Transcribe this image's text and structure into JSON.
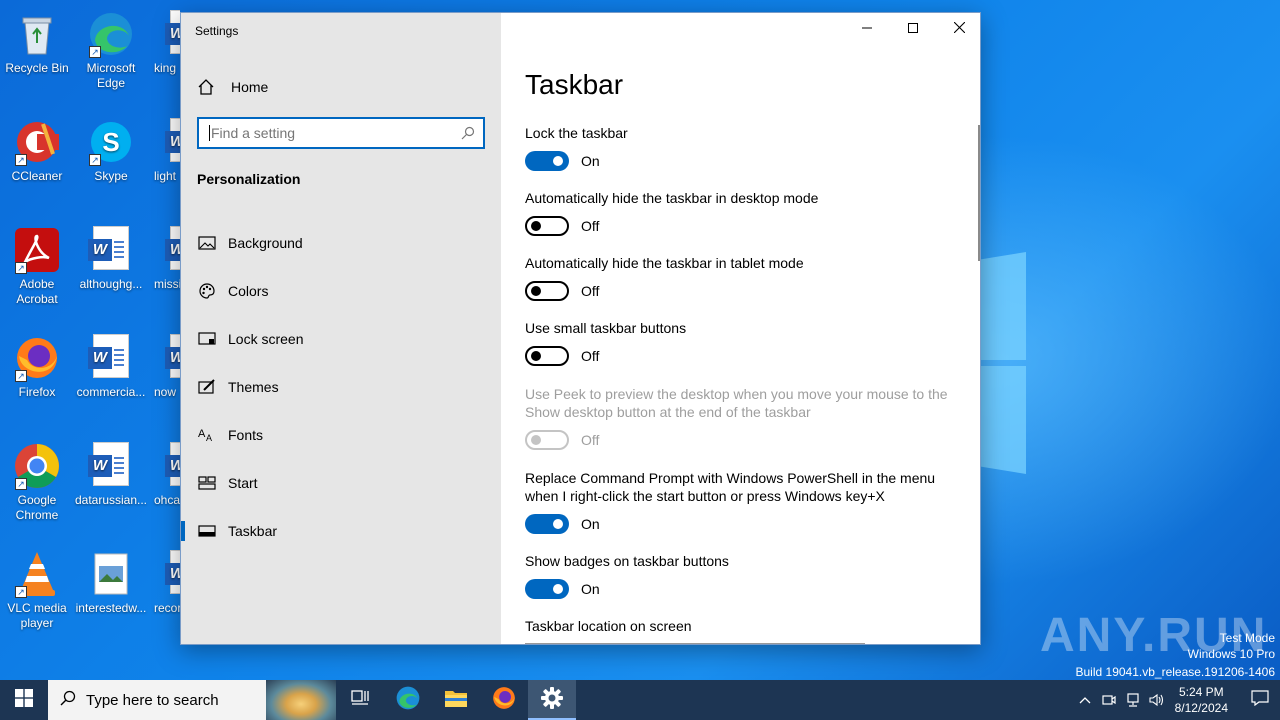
{
  "desktop": {
    "icons": [
      {
        "label": "Recycle Bin",
        "icon": "recycle-bin-icon"
      },
      {
        "label": "Microsoft Edge",
        "icon": "edge-icon"
      },
      {
        "label": "king",
        "icon": "word-doc-icon"
      },
      {
        "label": "CCleaner",
        "icon": "ccleaner-icon"
      },
      {
        "label": "Skype",
        "icon": "skype-icon"
      },
      {
        "label": "light",
        "icon": "word-doc-icon"
      },
      {
        "label": "Adobe Acrobat",
        "icon": "acrobat-icon"
      },
      {
        "label": "althoughg...",
        "icon": "word-doc-icon"
      },
      {
        "label": "missi",
        "icon": "word-doc-icon"
      },
      {
        "label": "Firefox",
        "icon": "firefox-icon"
      },
      {
        "label": "commercia...",
        "icon": "word-doc-icon"
      },
      {
        "label": "now",
        "icon": "word-doc-icon"
      },
      {
        "label": "Google Chrome",
        "icon": "chrome-icon"
      },
      {
        "label": "datarussian...",
        "icon": "word-doc-icon"
      },
      {
        "label": "ohca",
        "icon": "word-doc-icon"
      },
      {
        "label": "VLC media player",
        "icon": "vlc-icon"
      },
      {
        "label": "interestedw...",
        "icon": "image-file-icon"
      },
      {
        "label": "recor",
        "icon": "word-doc-icon"
      }
    ]
  },
  "window": {
    "title": "Settings",
    "controls": {
      "minimize": "minimize-icon",
      "maximize": "maximize-icon",
      "close": "close-icon"
    }
  },
  "sidebar": {
    "home_label": "Home",
    "search_placeholder": "Find a setting",
    "section_title": "Personalization",
    "items": [
      {
        "label": "Background",
        "icon": "picture-icon",
        "active": false
      },
      {
        "label": "Colors",
        "icon": "palette-icon",
        "active": false
      },
      {
        "label": "Lock screen",
        "icon": "lock-screen-icon",
        "active": false
      },
      {
        "label": "Themes",
        "icon": "brush-icon",
        "active": false
      },
      {
        "label": "Fonts",
        "icon": "font-icon",
        "active": false
      },
      {
        "label": "Start",
        "icon": "start-icon",
        "active": false
      },
      {
        "label": "Taskbar",
        "icon": "taskbar-icon",
        "active": true
      }
    ]
  },
  "content": {
    "title": "Taskbar",
    "settings": [
      {
        "label": "Lock the taskbar",
        "state": "On",
        "on": true,
        "disabled": false
      },
      {
        "label": "Automatically hide the taskbar in desktop mode",
        "state": "Off",
        "on": false,
        "disabled": false
      },
      {
        "label": "Automatically hide the taskbar in tablet mode",
        "state": "Off",
        "on": false,
        "disabled": false
      },
      {
        "label": "Use small taskbar buttons",
        "state": "Off",
        "on": false,
        "disabled": false
      },
      {
        "label": "Use Peek to preview the desktop when you move your mouse to the Show desktop button at the end of the taskbar",
        "state": "Off",
        "on": false,
        "disabled": true
      },
      {
        "label": "Replace Command Prompt with Windows PowerShell in the menu when I right-click the start button or press Windows key+X",
        "state": "On",
        "on": true,
        "disabled": false
      },
      {
        "label": "Show badges on taskbar buttons",
        "state": "On",
        "on": true,
        "disabled": false
      }
    ],
    "location_label": "Taskbar location on screen"
  },
  "taskbar": {
    "search_placeholder": "Type here to search",
    "apps": [
      "task-view-icon",
      "edge-icon",
      "file-explorer-icon",
      "firefox-icon",
      "settings-gear-icon"
    ],
    "clock_time": "5:24 PM",
    "clock_date": "8/12/2024"
  },
  "watermark": {
    "brand": "ANY.RUN",
    "line1": "Test Mode",
    "line2": "Windows 10 Pro",
    "line3": "Build 19041.vb_release.191206-1406"
  },
  "colors": {
    "accent": "#0067c0",
    "sidebar_bg": "#e6e6e6",
    "taskbar_bg": "#1d3553"
  }
}
